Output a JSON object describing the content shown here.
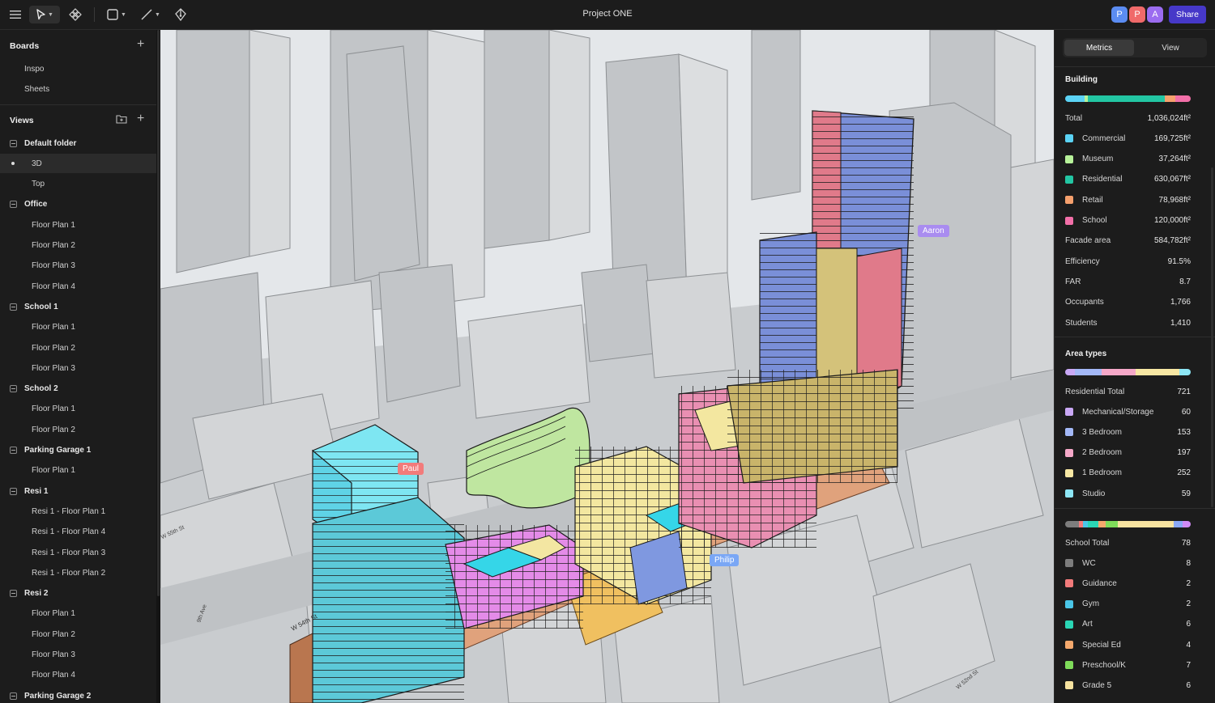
{
  "toolbar": {
    "title": "Project ONE",
    "avatars": [
      {
        "letter": "P",
        "color": "#5b8cf2"
      },
      {
        "letter": "P",
        "color": "#f06a6a"
      },
      {
        "letter": "A",
        "color": "#9b6cf0"
      }
    ],
    "share_label": "Share",
    "tools": [
      "menu-icon",
      "select-tool-icon",
      "component-icon",
      "rectangle-tool-icon",
      "line-tool-icon",
      "pen-tool-icon"
    ]
  },
  "sidebar": {
    "boards_header": "Boards",
    "boards": [
      "Inspo",
      "Sheets"
    ],
    "views_header": "Views",
    "tree": [
      {
        "label": "Default folder",
        "type": "folder"
      },
      {
        "label": "3D",
        "type": "selected"
      },
      {
        "label": "Top",
        "type": "item"
      },
      {
        "label": "Office",
        "type": "folder"
      },
      {
        "label": "Floor Plan 1",
        "type": "item"
      },
      {
        "label": "Floor Plan 2",
        "type": "item"
      },
      {
        "label": "Floor Plan 3",
        "type": "item"
      },
      {
        "label": "Floor Plan 4",
        "type": "item"
      },
      {
        "label": "School 1",
        "type": "folder"
      },
      {
        "label": "Floor Plan 1",
        "type": "item"
      },
      {
        "label": "Floor Plan 2",
        "type": "item"
      },
      {
        "label": "Floor Plan 3",
        "type": "item"
      },
      {
        "label": "School 2",
        "type": "folder"
      },
      {
        "label": "Floor Plan 1",
        "type": "item"
      },
      {
        "label": "Floor Plan 2",
        "type": "item"
      },
      {
        "label": "Parking Garage 1",
        "type": "folder"
      },
      {
        "label": "Floor Plan 1",
        "type": "item"
      },
      {
        "label": "Resi 1",
        "type": "folder"
      },
      {
        "label": "Resi 1 - Floor Plan 1",
        "type": "item"
      },
      {
        "label": "Resi 1 - Floor Plan 4",
        "type": "item"
      },
      {
        "label": "Resi 1 - Floor Plan 3",
        "type": "item"
      },
      {
        "label": "Resi 1 - Floor Plan 2",
        "type": "item"
      },
      {
        "label": "Resi 2",
        "type": "folder"
      },
      {
        "label": "Floor Plan 1",
        "type": "item"
      },
      {
        "label": "Floor Plan 2",
        "type": "item"
      },
      {
        "label": "Floor Plan 3",
        "type": "item"
      },
      {
        "label": "Floor Plan 4",
        "type": "item"
      },
      {
        "label": "Parking Garage 2",
        "type": "folder"
      }
    ]
  },
  "viewport": {
    "cursors": [
      {
        "name": "Aaron",
        "color": "#a98cf0"
      },
      {
        "name": "Paul",
        "color": "#f27b7b"
      },
      {
        "name": "Philip",
        "color": "#7aa7f5"
      }
    ],
    "street_labels": [
      "W 55th St",
      "9th Ave",
      "W 54th St",
      "W 52nd St"
    ]
  },
  "metrics": {
    "tabs": [
      "Metrics",
      "View"
    ],
    "building": {
      "header": "Building",
      "bar": [
        {
          "color": "#5bd3f5",
          "weight": 15
        },
        {
          "color": "#b7f29a",
          "weight": 3
        },
        {
          "color": "#23c6a3",
          "weight": 60
        },
        {
          "color": "#f5a06d",
          "weight": 8
        },
        {
          "color": "#f26fa8",
          "weight": 12
        }
      ],
      "rows": [
        {
          "label": "Total",
          "value": "1,036,024ft²"
        },
        {
          "label": "Commercial",
          "value": "169,725ft²",
          "color": "#5bd3f5"
        },
        {
          "label": "Museum",
          "value": "37,264ft²",
          "color": "#b7f29a"
        },
        {
          "label": "Residential",
          "value": "630,067ft²",
          "color": "#23c6a3"
        },
        {
          "label": "Retail",
          "value": "78,968ft²",
          "color": "#f5a06d"
        },
        {
          "label": "School",
          "value": "120,000ft²",
          "color": "#f26fa8"
        },
        {
          "label": "Facade area",
          "value": "584,782ft²"
        },
        {
          "label": "Efficiency",
          "value": "91.5%"
        },
        {
          "label": "FAR",
          "value": "8.7"
        },
        {
          "label": "Occupants",
          "value": "1,766"
        },
        {
          "label": "Students",
          "value": "1,410"
        }
      ]
    },
    "area_types": {
      "header": "Area types",
      "bar": [
        {
          "color": "#c9a8f5",
          "weight": 8
        },
        {
          "color": "#a3b8f7",
          "weight": 21
        },
        {
          "color": "#f5a8c8",
          "weight": 27
        },
        {
          "color": "#f7e7a3",
          "weight": 35
        },
        {
          "color": "#8de6f5",
          "weight": 9
        }
      ],
      "rows": [
        {
          "label": "Residential Total",
          "value": "721"
        },
        {
          "label": "Mechanical/Storage",
          "value": "60",
          "color": "#c9a8f5"
        },
        {
          "label": "3 Bedroom",
          "value": "153",
          "color": "#a3b8f7"
        },
        {
          "label": "2 Bedroom",
          "value": "197",
          "color": "#f5a8c8"
        },
        {
          "label": "1 Bedroom",
          "value": "252",
          "color": "#f7e7a3"
        },
        {
          "label": "Studio",
          "value": "59",
          "color": "#8de6f5"
        }
      ]
    },
    "school": {
      "bar": [
        {
          "color": "#7d7d7d",
          "weight": 10
        },
        {
          "color": "#f27b7b",
          "weight": 3
        },
        {
          "color": "#4ac6e8",
          "weight": 3
        },
        {
          "color": "#2ad6b5",
          "weight": 8
        },
        {
          "color": "#f5a96d",
          "weight": 5
        },
        {
          "color": "#7fdc5a",
          "weight": 9
        },
        {
          "color": "#f7e3a0",
          "weight": 40
        },
        {
          "color": "#8aa8f5",
          "weight": 6
        },
        {
          "color": "#d08af5",
          "weight": 6
        }
      ],
      "rows": [
        {
          "label": "School Total",
          "value": "78"
        },
        {
          "label": "WC",
          "value": "8",
          "color": "#7d7d7d"
        },
        {
          "label": "Guidance",
          "value": "2",
          "color": "#f27b7b"
        },
        {
          "label": "Gym",
          "value": "2",
          "color": "#4ac6e8"
        },
        {
          "label": "Art",
          "value": "6",
          "color": "#2ad6b5"
        },
        {
          "label": "Special Ed",
          "value": "4",
          "color": "#f5a96d"
        },
        {
          "label": "Preschool/K",
          "value": "7",
          "color": "#7fdc5a"
        },
        {
          "label": "Grade 5",
          "value": "6",
          "color": "#f7e3a0"
        }
      ]
    }
  }
}
